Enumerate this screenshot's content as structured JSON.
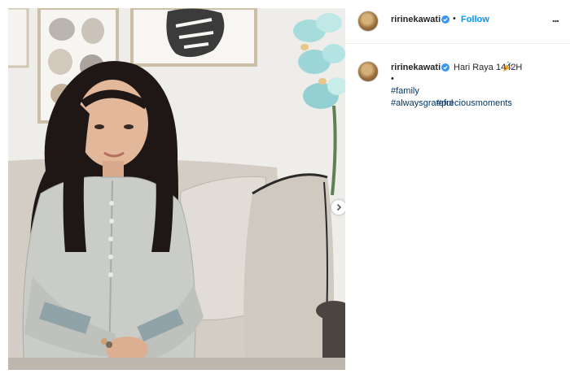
{
  "post": {
    "username": "ririnekawati",
    "follow_label": "Follow",
    "separator": "•",
    "more_label": "...",
    "caption": {
      "text": "Hari Raya 1442H",
      "bullet": "•",
      "hashtags": [
        "#family",
        "#alwaysgrateful",
        "#preciousmoments"
      ]
    }
  },
  "icons": {
    "verified": "verified-badge-icon",
    "party": "party-popper-icon",
    "next": "chevron-right-icon"
  },
  "colors": {
    "follow": "#0095f6",
    "verified": "#3897f0",
    "hashtag": "#00376b"
  }
}
